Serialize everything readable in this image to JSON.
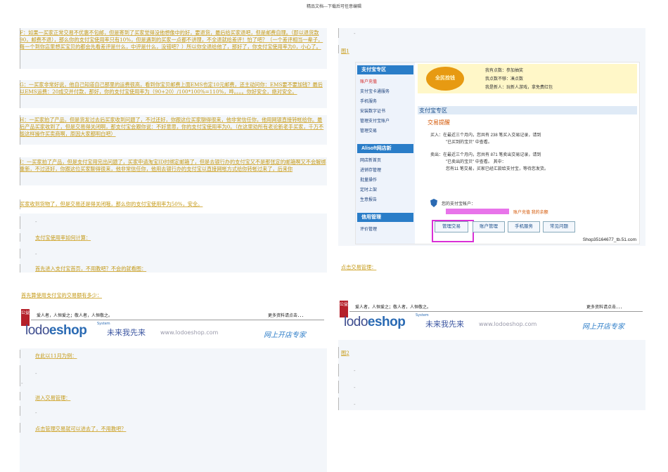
{
  "header": "精品文档---下载后可任意编辑",
  "left": {
    "paras": {
      "f": "F：如果一买家正常交易不优惠不包邮，但是寄到了买家觉得没他想像中的好，要退货，最后给买家退吧，但是邮费自理。（即以退货款90，邮费不退），那么你的支付宝使用率只有10%，但是遇到的买家一点都不讲理，不全退就给差评！怕了吧？（一个差评相当一辈子，每一个到你店里想买宝贝的都会先看差评是什么，中评是什么，没错吧？）所以你全退给他了，那好了，你支付宝使用率为0，小心了。",
      "g": "G：一买家非常好说，他自己知道自己那里的运费很高，看到你宝贝邮费上面EMS也定10元邮费，还主动问你：EMS要不要加钱？最后以EMS运费：20成交并付款，那好，你的支付宝使用率为（90+20）/100*100%=110%，哗。。。。你好安全，绝对安全。",
      "h": "H：一买家拍了产品，但是货发过去后买家收到问题了，不过还好，你跟这位买家聊得很来，他非常信任你，他用网银直接转帐给你。最后产品买家收到了，但是交易得关闭啊，那支付宝会跟你说：不好意思，你的支付宝使用率为0。（在这里劝所有老论新老手买家，千万不能这样操作买卖商啊，原因大家都明白吧）",
      "i": "I：一买家拍了产品，但是支付宝用完出问题了，买家申请淘宝ID时绑定邮箱了，但是去银行办的支付宝又不是那张定的邮箱啊又不会解绑重新，不过还好，你跟这位买家聊得很来，他非常信任你，他用去银行办的支付宝以直接网帐方式给你转帐过来了，后来你",
      "j": "买家收到货物了，但是交易还是得关闭哦，那么你的支付宝使用率为50%，安全。"
    },
    "link1": "支付宝使用率如何计算：",
    "link2": "首先进入支付宝首页，不用教吧？不会的就看图：",
    "link3": "首先算使用支付宝的交易额有多少：",
    "link4": "在此以11月为例：",
    "link5": "进入交易管理：",
    "link6": "点击管理交易就可以进去了，不用教吧？"
  },
  "banner": {
    "tag": "公益",
    "line": "爱人者，人恒爱之；敬人者，人恒敬之。",
    "more": "更多资料请点击．．．",
    "logo_a": "lodo",
    "logo_b": "eshop",
    "system": "System",
    "slogan": "未来我先来",
    "url": "www.lodoeshop.com",
    "expert": "网上开店专家"
  },
  "right": {
    "fig1": "图1",
    "click": "点击交易管理：",
    "fig2": "图2"
  },
  "shot": {
    "sec1": "支付宝专区",
    "items1": [
      "账户充值",
      "支付宝卡通服务",
      "手机服务",
      "安装数字证书",
      "管理支付宝账户",
      "管理交易"
    ],
    "sec2": "Alisoft网店新",
    "items2": [
      "网店新首页",
      "进销存管理",
      "批量操作",
      "定时上架",
      "生意报告"
    ],
    "sec3": "信用管理",
    "items3": [
      "评价管理"
    ],
    "badge": "全民捡钱",
    "promo": [
      "我有点数：参加抽奖",
      "我点数不够：凑点数",
      "我是新人：玩新人游戏，拿免费红包"
    ],
    "zfb_title": "支付宝专区",
    "remind": "交易提醒",
    "buy1": "买入：在最近三个月内，您共有 238 笔买入交易记录，请到",
    "buy2": "\"已买到的宝贝\" 中查看。",
    "sell1": "卖出：在最近三个月内，您共有 871 笔卖出交易记录，请到",
    "sell2": "\"已卖出的宝贝\" 中查看。  其中：",
    "sell3": "您有11 笔交易，买家已经汇款给支付宝，等待您发货。",
    "acct": "您的支付宝帐户：",
    "acct_links": "账户充值  我的余额",
    "btns": [
      "管理交易",
      "账户管理",
      "手机服务",
      "常见问题"
    ],
    "shop": "Shop35164677_tb.51.com"
  }
}
